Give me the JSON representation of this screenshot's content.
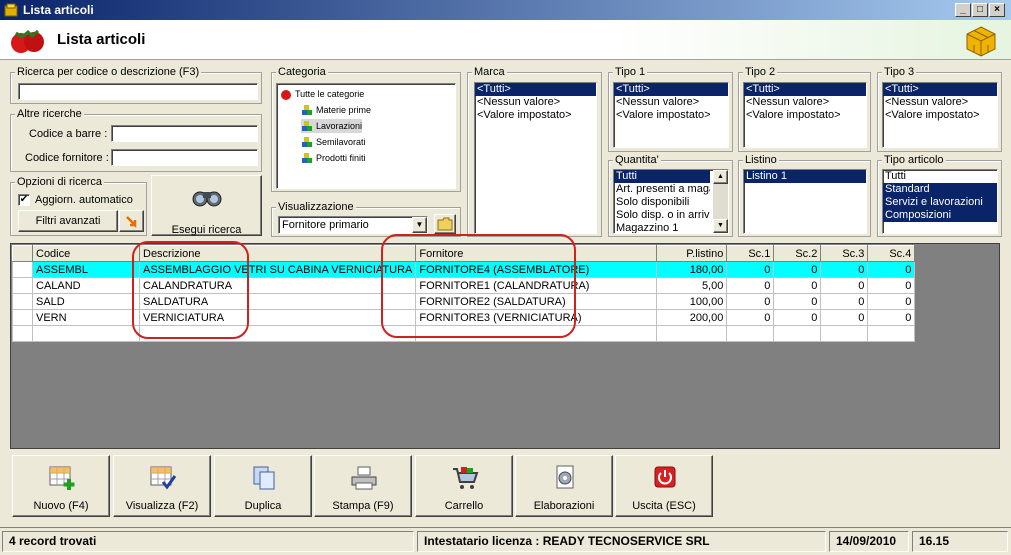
{
  "window": {
    "title": "Lista articoli",
    "min": "_",
    "max": "□",
    "close": "×"
  },
  "header": {
    "title": "Lista articoli"
  },
  "search": {
    "label": "Ricerca per codice o descrizione (F3)",
    "value": ""
  },
  "other": {
    "label": "Altre ricerche",
    "barcode_label": "Codice a barre :",
    "supplier_code_label": "Codice fornitore :"
  },
  "options": {
    "label": "Opzioni di ricerca",
    "auto_update": "Aggiorn. automatico",
    "auto_checked": true,
    "advanced_filters": "Filtri avanzati"
  },
  "run_search": "Esegui ricerca",
  "category": {
    "label": "Categoria",
    "items": [
      "Tutte le categorie",
      "Materie prime",
      "Lavorazioni",
      "Semilavorati",
      "Prodotti finiti"
    ]
  },
  "view": {
    "label": "Visualizzazione",
    "value": "Fornitore primario"
  },
  "brand": {
    "label": "Marca",
    "items": [
      "<Tutti>",
      "<Nessun valore>",
      "<Valore impostato>"
    ]
  },
  "type1": {
    "label": "Tipo 1",
    "items": [
      "<Tutti>",
      "<Nessun valore>",
      "<Valore impostato>"
    ]
  },
  "type2": {
    "label": "Tipo 2",
    "items": [
      "<Tutti>",
      "<Nessun valore>",
      "<Valore impostato>"
    ]
  },
  "type3": {
    "label": "Tipo 3",
    "items": [
      "<Tutti>",
      "<Nessun valore>",
      "<Valore impostato>"
    ]
  },
  "quantity": {
    "label": "Quantita'",
    "items": [
      "Tutti",
      "Art. presenti a magazzino",
      "Solo disponibili",
      "Solo disp. o in arrivo",
      "Magazzino 1"
    ]
  },
  "pricelist": {
    "label": "Listino",
    "items": [
      "Listino 1"
    ]
  },
  "article_type": {
    "label": "Tipo articolo",
    "items": [
      "Tutti",
      "Standard",
      "Servizi e lavorazioni",
      "Composizioni"
    ]
  },
  "grid": {
    "headers": [
      "Codice",
      "Descrizione",
      "Fornitore",
      "P.listino",
      "Sc.1",
      "Sc.2",
      "Sc.3",
      "Sc.4"
    ],
    "rows": [
      [
        "ASSEMBL",
        "ASSEMBLAGGIO VETRI SU CABINA VERNICIATURA",
        "FORNITORE4 (ASSEMBLATORE)",
        "180,00",
        "0",
        "0",
        "0",
        "0"
      ],
      [
        "CALAND",
        "CALANDRATURA",
        "FORNITORE1 (CALANDRATURA)",
        "5,00",
        "0",
        "0",
        "0",
        "0"
      ],
      [
        "SALD",
        "SALDATURA",
        "FORNITORE2 (SALDATURA)",
        "100,00",
        "0",
        "0",
        "0",
        "0"
      ],
      [
        "VERN",
        "VERNICIATURA",
        "FORNITORE3 (VERNICIATURA)",
        "200,00",
        "0",
        "0",
        "0",
        "0"
      ]
    ]
  },
  "toolbar": {
    "new": "Nuovo (F4)",
    "view": "Visualizza (F2)",
    "duplicate": "Duplica",
    "print": "Stampa (F9)",
    "cart": "Carrello",
    "process": "Elaborazioni",
    "exit": "Uscita (ESC)"
  },
  "status": {
    "records": "4 record trovati",
    "license": "Intestatario licenza : READY TECNOSERVICE SRL",
    "date": "14/09/2010",
    "time": "16.15"
  },
  "colors": {
    "title_start": "#0a246a",
    "highlight_row": "#00ffff",
    "selection": "#0a246a",
    "annotation": "#d02020"
  }
}
